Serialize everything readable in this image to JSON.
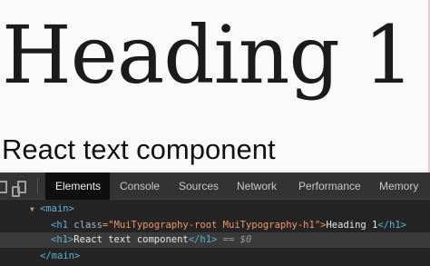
{
  "page": {
    "heading1": "Heading 1",
    "react_text": "React text component"
  },
  "devtools": {
    "tabs": [
      {
        "label": "Elements",
        "active": true
      },
      {
        "label": "Console",
        "active": false
      },
      {
        "label": "Sources",
        "active": false
      },
      {
        "label": "Network",
        "active": false
      },
      {
        "label": "Performance",
        "active": false
      },
      {
        "label": "Memory",
        "active": false
      }
    ],
    "dom": {
      "main_open": "<main>",
      "h1_open_start": "<h1 ",
      "h1_attr_name": "class",
      "h1_attr_eq": "=\"",
      "h1_attr_value": "MuiTypography-root MuiTypography-h1",
      "h1_attr_end": "\">",
      "h1_text": "Heading 1",
      "h1_close": "</h1>",
      "h1b_open": "<h1>",
      "h1b_text": "React text component",
      "h1b_close": "</h1>",
      "selected_marker": "== $0",
      "main_close": "</main>",
      "expand_arrow": "▼"
    }
  }
}
